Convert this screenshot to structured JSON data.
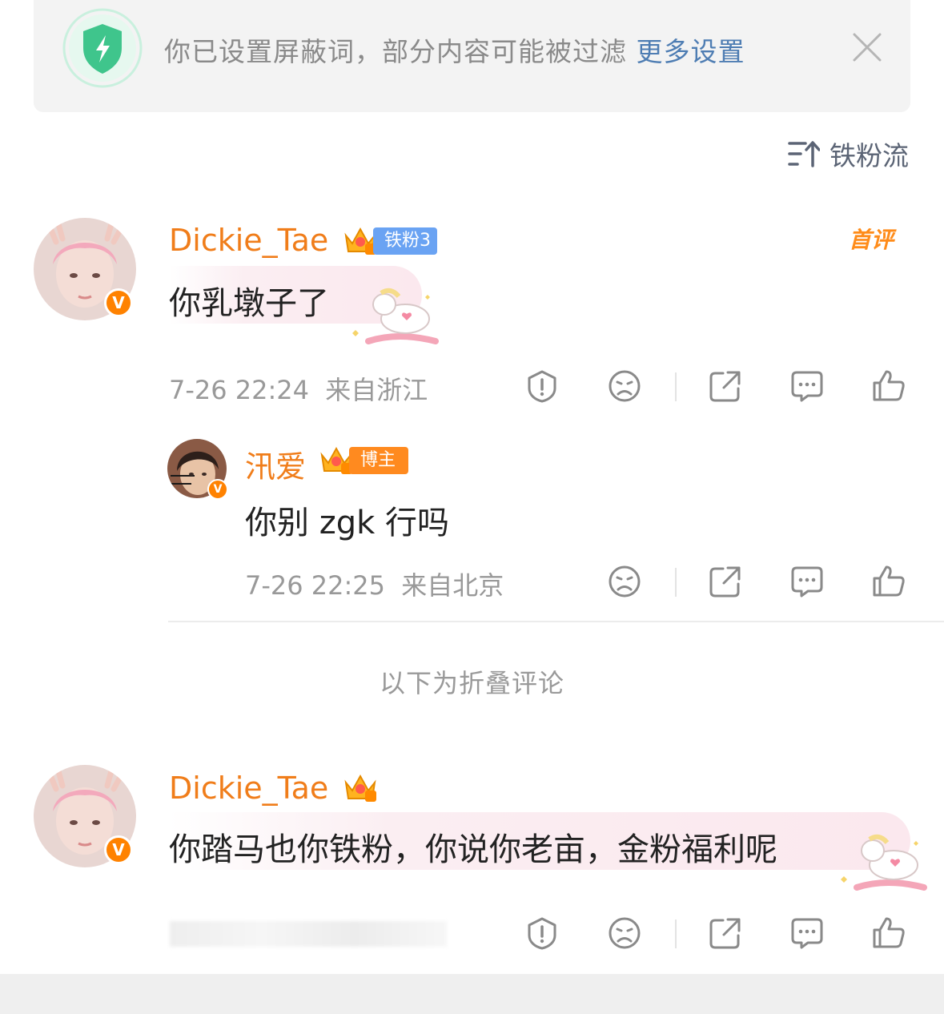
{
  "banner": {
    "message": "你已设置屏蔽词，部分内容可能被过滤",
    "link": "更多设置"
  },
  "sort": {
    "label": "铁粉流"
  },
  "comments": [
    {
      "username": "Dickie_Tae",
      "fan_tag": "铁粉3",
      "first_badge": "首评",
      "text": "你乳墩子了",
      "time": "7-26 22:24",
      "location": "来自浙江",
      "reply": {
        "username": "汛爱",
        "host_tag": "博主",
        "text": "你别 zgk 行吗",
        "time": "7-26 22:25",
        "location": "来自北京"
      }
    },
    {
      "username": "Dickie_Tae",
      "text": "你踏马也你铁粉，你说你老亩，金粉福利呢"
    }
  ],
  "folded_label": "以下为折叠评论",
  "colors": {
    "accent_orange": "#f07d1a",
    "link_blue": "#4e7db3",
    "fan_tag_blue": "#6aa3f3",
    "host_tag_orange": "#ff8a1f"
  }
}
